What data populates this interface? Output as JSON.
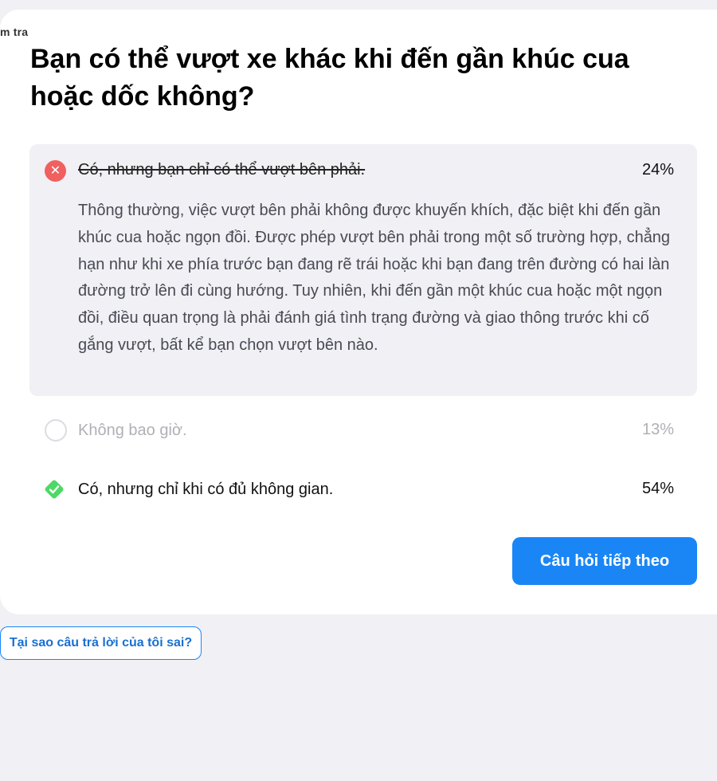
{
  "breadcrumb": "m tra",
  "question": "Bạn có thể vượt xe khác khi đến gần khúc cua hoặc dốc không?",
  "options": [
    {
      "label": "Có, nhưng bạn chỉ có thể vượt bên phải.",
      "percent": "24%",
      "state": "wrong-selected",
      "icon": "x-circle-icon",
      "explanation": "Thông thường, việc vượt bên phải không được khuyến khích, đặc biệt khi đến gần khúc cua hoặc ngọn đồi. Được phép vượt bên phải trong một số trường hợp, chẳng hạn như khi xe phía trước bạn đang rẽ trái hoặc khi bạn đang trên đường có hai làn đường trở lên đi cùng hướng. Tuy nhiên, khi đến gần một khúc cua hoặc một ngọn đồi, điều quan trọng là phải đánh giá tình trạng đường và giao thông trước khi cố gắng vượt, bất kể bạn chọn vượt bên nào."
    },
    {
      "label": "Không bao giờ.",
      "percent": "13%",
      "state": "unselected",
      "icon": "empty-radio-icon"
    },
    {
      "label": "Có, nhưng chỉ khi có đủ không gian.",
      "percent": "54%",
      "state": "correct",
      "icon": "check-diamond-icon"
    }
  ],
  "next_button": "Câu hỏi tiếp theo",
  "why_button": "Tại sao câu trả lời của tôi sai?",
  "colors": {
    "background": "#f0f0f5",
    "card": "#ffffff",
    "wrong": "#f0605f",
    "correct": "#4cd964",
    "primary": "#1a86f5",
    "muted": "#b0b0b6"
  }
}
